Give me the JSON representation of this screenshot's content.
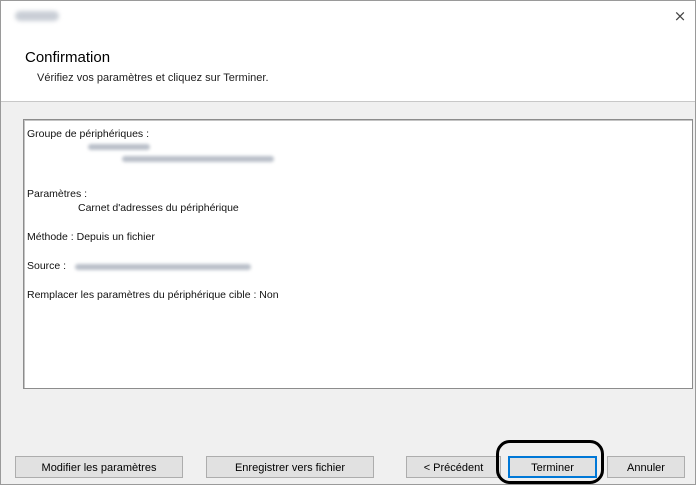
{
  "window": {
    "title_blurred": true,
    "close_symbol": "×"
  },
  "header": {
    "title": "Confirmation",
    "subtitle": "Vérifiez vos paramètres et cliquez sur Terminer."
  },
  "summary": {
    "device_group_label": "Groupe de périphériques :",
    "settings_label": "Paramètres :",
    "settings_value": "Carnet d'adresses du périphérique",
    "method_line": "Méthode : Depuis un fichier",
    "source_label": "Source :",
    "replace_line": "Remplacer les paramètres du périphérique cible : Non"
  },
  "buttons": {
    "modify": "Modifier les paramètres",
    "save_to_file": "Enregistrer vers fichier",
    "previous": "< Précédent",
    "finish": "Terminer",
    "cancel": "Annuler"
  },
  "colors": {
    "body_background": "#f0f0f0",
    "button_face": "#e1e1e1",
    "default_button_border": "#0078d7",
    "highlight_ring": "#000000"
  },
  "icons": {
    "close": "close-icon"
  }
}
